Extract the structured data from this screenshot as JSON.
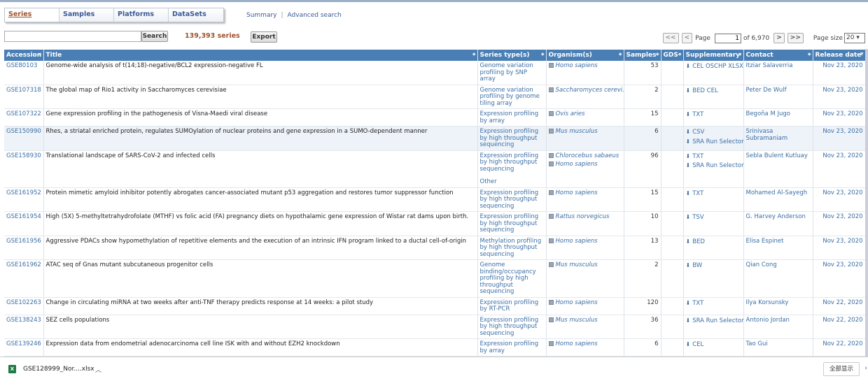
{
  "tabs": [
    {
      "label": "Series",
      "active": true
    },
    {
      "label": "Samples",
      "active": false
    },
    {
      "label": "Platforms",
      "active": false
    },
    {
      "label": "DataSets",
      "active": false
    }
  ],
  "links": {
    "summary": "Summary",
    "separator": "|",
    "advanced": "Advanced search"
  },
  "search": {
    "placeholder": "",
    "button": "Search"
  },
  "result_count": "139,393 series",
  "export_label": "Export",
  "pager": {
    "first": "<<",
    "prev": "<",
    "page_label": "Page",
    "current_page": "1",
    "of_label": "of 6,970",
    "next": ">",
    "last": ">>",
    "page_size_label": "Page size",
    "page_size": "20"
  },
  "columns": [
    "Accession",
    "Title",
    "Series type(s)",
    "Organism(s)",
    "Samples",
    "GDS",
    "Supplementary",
    "Contact",
    "Release date"
  ],
  "rows": [
    {
      "accession": "GSE80103",
      "title": "Genome-wide analysis of t(14;18)-negative/BCL2 expression-negative FL",
      "type": "Genome variation profiling by SNP array",
      "organisms": [
        "Homo sapiens"
      ],
      "samples": "53",
      "gds": "",
      "supp": [
        "CEL OSCHP XLSX"
      ],
      "contact": "Itziar Salaverria",
      "date": "Nov 23, 2020"
    },
    {
      "accession": "GSE107318",
      "title": "The global map of Rio1 activity in Saccharomyces cerevisiae",
      "type": "Genome variation profiling by genome tiling array",
      "organisms": [
        "Saccharomyces cerevi..."
      ],
      "samples": "2",
      "gds": "",
      "supp": [
        "BED CEL"
      ],
      "contact": "Peter De Wulf",
      "date": "Nov 23, 2020"
    },
    {
      "accession": "GSE107322",
      "title": "Gene expression profiling in the pathogenesis of Visna-Maedi viral disease",
      "type": "Expression profiling by array",
      "organisms": [
        "Ovis aries"
      ],
      "samples": "15",
      "gds": "",
      "supp": [
        "TXT"
      ],
      "contact": "Begoña M Jugo",
      "date": "Nov 23, 2020"
    },
    {
      "accession": "GSE150990",
      "title": "Rhes, a striatal enriched protein, regulates SUMOylation of nuclear proteins and gene expression in a SUMO-dependent manner",
      "type": "Expression profiling by high throughput sequencing",
      "organisms": [
        "Mus musculus"
      ],
      "samples": "6",
      "gds": "",
      "supp": [
        "CSV",
        "SRA Run Selector"
      ],
      "contact": "Srinivasa Subramaniam",
      "date": "Nov 23, 2020",
      "highlight": true
    },
    {
      "accession": "GSE158930",
      "title": "Translational landscape of SARS-CoV-2 and infected cells",
      "type": "Expression profiling by high throughput sequencing",
      "type_extra": "Other",
      "organisms": [
        "Chlorocebus sabaeus",
        "Homo sapiens"
      ],
      "samples": "96",
      "gds": "",
      "supp": [
        "TXT",
        "SRA Run Selector"
      ],
      "contact": "Sebla Bulent Kutluay",
      "date": "Nov 23, 2020"
    },
    {
      "accession": "GSE161952",
      "title": "Protein mimetic amyloid inhibitor potently abrogates cancer-associated mutant p53 aggregation and restores tumor suppressor function",
      "type": "Expression profiling by high throughput sequencing",
      "organisms": [
        "Homo sapiens"
      ],
      "samples": "15",
      "gds": "",
      "supp": [
        "TXT"
      ],
      "contact": "Mohamed Al-Sayegh",
      "date": "Nov 23, 2020"
    },
    {
      "accession": "GSE161954",
      "title": "High (5X) 5-methyltetrahydrofolate (MTHF) vs folic acid (FA) pregnancy diets on hypothalamic gene expression of Wistar rat dams upon birth.",
      "type": "Expression profiling by high throughput sequencing",
      "organisms": [
        "Rattus norvegicus"
      ],
      "samples": "10",
      "gds": "",
      "supp": [
        "TSV"
      ],
      "contact": "G. Harvey Anderson",
      "date": "Nov 23, 2020"
    },
    {
      "accession": "GSE161956",
      "title": "Aggressive PDACs show hypomethylation of repetitive elements and the execution of an intrinsic IFN program linked to a ductal cell-of-origin",
      "type": "Methylation profiling by high throughput sequencing",
      "organisms": [
        "Homo sapiens"
      ],
      "samples": "13",
      "gds": "",
      "supp": [
        "BED"
      ],
      "contact": "Elisa Espinet",
      "date": "Nov 23, 2020"
    },
    {
      "accession": "GSE161962",
      "title": "ATAC seq of Gnas mutant subcutaneous progenitor cells",
      "type": "Genome binding/occupancy profiling by high throughput sequencing",
      "organisms": [
        "Mus musculus"
      ],
      "samples": "2",
      "gds": "",
      "supp": [
        "BW"
      ],
      "contact": "Qian Cong",
      "date": "Nov 23, 2020"
    },
    {
      "accession": "GSE102263",
      "title": "Change in circulating miRNA at two weeks after anti-TNF therapy predicts response at 14 weeks: a pilot study",
      "type": "Expression profiling by RT-PCR",
      "organisms": [
        "Homo sapiens"
      ],
      "samples": "120",
      "gds": "",
      "supp": [
        "TXT"
      ],
      "contact": "Ilya Korsunsky",
      "date": "Nov 22, 2020"
    },
    {
      "accession": "GSE138243",
      "title": "SEZ cells populations",
      "type": "Expression profiling by high throughput sequencing",
      "organisms": [
        "Mus musculus"
      ],
      "samples": "36",
      "gds": "",
      "supp": [
        "SRA Run Selector"
      ],
      "contact": "Antonio Jordan",
      "date": "Nov 22, 2020"
    },
    {
      "accession": "GSE139246",
      "title": "Expression data from endometrial adenocarcinoma cell line ISK with and without EZH2 knockdown",
      "type": "Expression profiling by array",
      "organisms": [
        "Homo sapiens"
      ],
      "samples": "6",
      "gds": "",
      "supp": [
        "CEL"
      ],
      "contact": "Tao Gui",
      "date": "Nov 22, 2020"
    }
  ],
  "download_bar": {
    "file_name": "GSE128999_Nor....xlsx",
    "file_icon": "X",
    "show_all": "全部显示"
  }
}
